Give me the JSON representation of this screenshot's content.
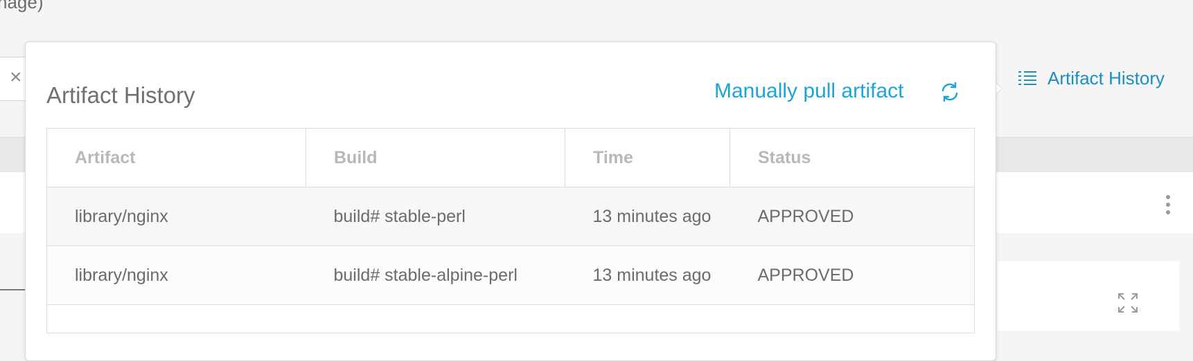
{
  "background": {
    "top_text": "nage)",
    "close_glyph": "×"
  },
  "history_link": {
    "label": "Artifact History",
    "icon": "list-icon"
  },
  "popover": {
    "title": "Artifact History",
    "pull_label": "Manually pull artifact",
    "refresh_icon": "refresh-icon",
    "table": {
      "headers": [
        "Artifact",
        "Build",
        "Time",
        "Status"
      ],
      "rows": [
        {
          "artifact": "library/nginx",
          "build": "build# stable-perl",
          "time": "13 minutes ago",
          "status": "APPROVED"
        },
        {
          "artifact": "library/nginx",
          "build": "build# stable-alpine-perl",
          "time": "13 minutes ago",
          "status": "APPROVED"
        }
      ]
    }
  },
  "colors": {
    "accent": "#19a6d6",
    "link": "#1b8fc4",
    "text": "#6b6b6b",
    "header_text": "#b8b8b8"
  }
}
